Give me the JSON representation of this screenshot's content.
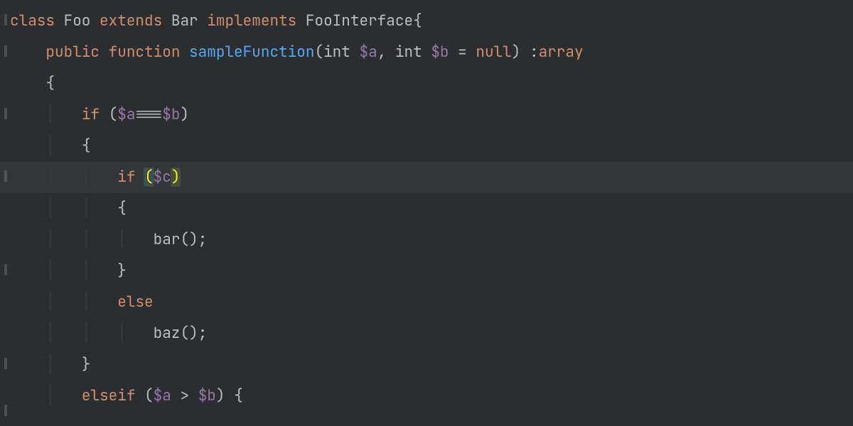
{
  "colors": {
    "bg": "#2b2d30",
    "fg": "#bcbec4",
    "keyword": "#cf8e6d",
    "function": "#56a8f5",
    "variable": "#9876aa",
    "guide": "#383a3e",
    "current_line": "rgba(255,255,255,0.04)",
    "bracket_match_bg1": "#3b514d",
    "bracket_match_bg2": "#43503a",
    "bracket_match_fg": "#ffef28"
  },
  "tokens": {
    "kw_class": "class",
    "cls_foo": "Foo",
    "kw_extends": "extends",
    "cls_bar": "Bar",
    "kw_implements": "implements",
    "cls_foointerface": "FooInterface",
    "brace_open": "{",
    "brace_close": "}",
    "kw_public": "public",
    "kw_function": "function",
    "fn_sample": "sampleFunction",
    "paren_open": "(",
    "paren_close": ")",
    "type_int": "int",
    "var_a": "$a",
    "var_b": "$b",
    "var_c": "$c",
    "comma": ",",
    "eq": "=",
    "kw_null": "null",
    "colon": ":",
    "type_array": "array",
    "kw_if": "if",
    "op_identical": "===",
    "op_gt": ">",
    "kw_else": "else",
    "kw_elseif": "elseif",
    "call_bar": "bar",
    "call_baz": "baz",
    "semi": ";"
  },
  "current_line_index": 5
}
